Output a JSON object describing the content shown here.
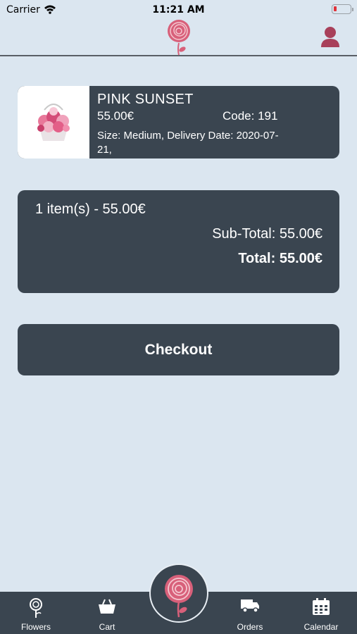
{
  "status_bar": {
    "carrier": "Carrier",
    "time": "11:21 AM",
    "battery_level": 0.12
  },
  "colors": {
    "background": "#dbe6f0",
    "card": "#3a4550",
    "accent_pink": "#d8607a",
    "profile_icon": "#a8405a"
  },
  "header": {
    "logo_icon": "rose-logo-icon",
    "profile_icon": "user-icon"
  },
  "cart_item": {
    "name": "PINK SUNSET",
    "price": "55.00€",
    "code": "Code: 191",
    "details": "Size: Medium, Delivery Date: 2020-07-21,"
  },
  "summary": {
    "count": "1 item(s) - 55.00€",
    "subtotal": "Sub-Total: 55.00€",
    "total": "Total: 55.00€"
  },
  "checkout": {
    "label": "Checkout"
  },
  "tabs": [
    {
      "label": "Flowers",
      "icon": "flower-icon"
    },
    {
      "label": "Cart",
      "icon": "basket-icon"
    },
    {
      "label": "",
      "icon": "rose-logo-icon"
    },
    {
      "label": "Orders",
      "icon": "truck-icon"
    },
    {
      "label": "Calendar",
      "icon": "calendar-icon"
    }
  ]
}
